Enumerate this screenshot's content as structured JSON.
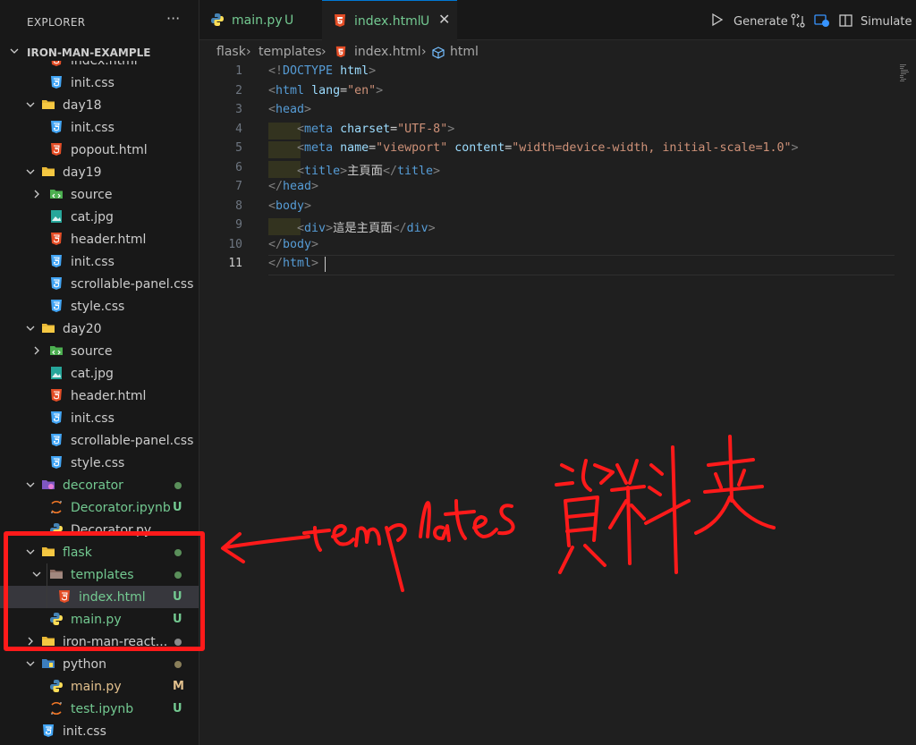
{
  "sidebar": {
    "title": "EXPLORER",
    "more_icon": "ellipsis-icon",
    "project": "IRON-MAN-EXAMPLE",
    "items": [
      {
        "label": "index.html",
        "type": "html",
        "depth": 2,
        "status": "",
        "partial": true
      },
      {
        "label": "init.css",
        "type": "css",
        "depth": 2,
        "status": ""
      },
      {
        "label": "day18",
        "type": "folder",
        "depth": 1,
        "expanded": true,
        "status": ""
      },
      {
        "label": "init.css",
        "type": "css",
        "depth": 2,
        "status": ""
      },
      {
        "label": "popout.html",
        "type": "html",
        "depth": 2,
        "status": ""
      },
      {
        "label": "day19",
        "type": "folder",
        "depth": 1,
        "expanded": true,
        "status": ""
      },
      {
        "label": "source",
        "type": "source-folder",
        "depth": 2,
        "expanded": false,
        "status": ""
      },
      {
        "label": "cat.jpg",
        "type": "image",
        "depth": 2,
        "status": ""
      },
      {
        "label": "header.html",
        "type": "html",
        "depth": 2,
        "status": ""
      },
      {
        "label": "init.css",
        "type": "css",
        "depth": 2,
        "status": ""
      },
      {
        "label": "scrollable-panel.css",
        "type": "css",
        "depth": 2,
        "status": ""
      },
      {
        "label": "style.css",
        "type": "css",
        "depth": 2,
        "status": ""
      },
      {
        "label": "day20",
        "type": "folder",
        "depth": 1,
        "expanded": true,
        "status": ""
      },
      {
        "label": "source",
        "type": "source-folder",
        "depth": 2,
        "expanded": false,
        "status": ""
      },
      {
        "label": "cat.jpg",
        "type": "image",
        "depth": 2,
        "status": ""
      },
      {
        "label": "header.html",
        "type": "html",
        "depth": 2,
        "status": ""
      },
      {
        "label": "init.css",
        "type": "css",
        "depth": 2,
        "status": ""
      },
      {
        "label": "scrollable-panel.css",
        "type": "css",
        "depth": 2,
        "status": ""
      },
      {
        "label": "style.css",
        "type": "css",
        "depth": 2,
        "status": ""
      },
      {
        "label": "decorator",
        "type": "decorator-folder",
        "depth": 1,
        "expanded": true,
        "status": "dot",
        "color": "#73c991"
      },
      {
        "label": "Decorator.ipynb",
        "type": "notebook",
        "depth": 2,
        "status": "U",
        "color": "#73c991"
      },
      {
        "label": "Decorator.py",
        "type": "python",
        "depth": 2,
        "status": "",
        "partial": true
      },
      {
        "label": "flask",
        "type": "folder",
        "depth": 1,
        "expanded": true,
        "status": "dot",
        "color": "#73c991"
      },
      {
        "label": "templates",
        "type": "template-folder",
        "depth": 2,
        "expanded": true,
        "status": "dot",
        "color": "#73c991"
      },
      {
        "label": "index.html",
        "type": "html",
        "depth": 3,
        "status": "U",
        "color": "#73c991",
        "selected": true
      },
      {
        "label": "main.py",
        "type": "python",
        "depth": 2,
        "status": "U",
        "color": "#73c991"
      },
      {
        "label": "iron-man-react...",
        "type": "folder",
        "depth": 1,
        "expanded": false,
        "status": "dot",
        "color": "#cccccc",
        "dotcolor": "#8a8a8a"
      },
      {
        "label": "python",
        "type": "python-folder",
        "depth": 1,
        "expanded": true,
        "status": "dot",
        "color": "#cccccc",
        "dotcolor": "#8a7f5a"
      },
      {
        "label": "main.py",
        "type": "python",
        "depth": 2,
        "status": "M",
        "color": "#e2c08d"
      },
      {
        "label": "test.ipynb",
        "type": "notebook",
        "depth": 2,
        "status": "U",
        "color": "#73c991"
      },
      {
        "label": "init.css",
        "type": "css",
        "depth": 1,
        "status": ""
      }
    ]
  },
  "tabs": [
    {
      "label": "main.py",
      "status": "U",
      "icon": "python-icon",
      "active": false
    },
    {
      "label": "index.html",
      "status": "U",
      "icon": "html5-icon",
      "active": true
    }
  ],
  "actions": {
    "generate_label": "Generate",
    "simulate_label": "Simulate"
  },
  "breadcrumb": {
    "items": [
      "flask",
      "templates",
      "index.html",
      "html"
    ]
  },
  "editor": {
    "line_numbers": [
      "1",
      "2",
      "3",
      "4",
      "5",
      "6",
      "7",
      "8",
      "9",
      "10",
      "11"
    ],
    "current_line": "11",
    "code": [
      [
        [
          "punc",
          "<!"
        ],
        [
          "tag",
          "DOCTYPE"
        ],
        [
          "text",
          " "
        ],
        [
          "attr",
          "html"
        ],
        [
          "punc",
          ">"
        ]
      ],
      [
        [
          "punc",
          "<"
        ],
        [
          "tag",
          "html"
        ],
        [
          "text",
          " "
        ],
        [
          "attr",
          "lang"
        ],
        [
          "text",
          "="
        ],
        [
          "str",
          "\"en\""
        ],
        [
          "punc",
          ">"
        ]
      ],
      [
        [
          "punc",
          "<"
        ],
        [
          "tag",
          "head"
        ],
        [
          "punc",
          ">"
        ]
      ],
      [
        [
          "ws",
          "    "
        ],
        [
          "punc",
          "<"
        ],
        [
          "tag",
          "meta"
        ],
        [
          "text",
          " "
        ],
        [
          "attr",
          "charset"
        ],
        [
          "text",
          "="
        ],
        [
          "str",
          "\"UTF-8\""
        ],
        [
          "punc",
          ">"
        ]
      ],
      [
        [
          "ws",
          "    "
        ],
        [
          "punc",
          "<"
        ],
        [
          "tag",
          "meta"
        ],
        [
          "text",
          " "
        ],
        [
          "attr",
          "name"
        ],
        [
          "text",
          "="
        ],
        [
          "str",
          "\"viewport\""
        ],
        [
          "text",
          " "
        ],
        [
          "attr",
          "content"
        ],
        [
          "text",
          "="
        ],
        [
          "str",
          "\"width=device-width, initial-scale=1.0\""
        ],
        [
          "punc",
          ">"
        ]
      ],
      [
        [
          "ws",
          "    "
        ],
        [
          "punc",
          "<"
        ],
        [
          "tag",
          "title"
        ],
        [
          "punc",
          ">"
        ],
        [
          "text",
          "主頁面"
        ],
        [
          "punc",
          "</"
        ],
        [
          "tag",
          "title"
        ],
        [
          "punc",
          ">"
        ]
      ],
      [
        [
          "punc",
          "</"
        ],
        [
          "tag",
          "head"
        ],
        [
          "punc",
          ">"
        ]
      ],
      [
        [
          "punc",
          "<"
        ],
        [
          "tag",
          "body"
        ],
        [
          "punc",
          ">"
        ]
      ],
      [
        [
          "ws",
          "    "
        ],
        [
          "punc",
          "<"
        ],
        [
          "tag",
          "div"
        ],
        [
          "punc",
          ">"
        ],
        [
          "text",
          "這是主頁面"
        ],
        [
          "punc",
          "</"
        ],
        [
          "tag",
          "div"
        ],
        [
          "punc",
          ">"
        ]
      ],
      [
        [
          "punc",
          "</"
        ],
        [
          "tag",
          "body"
        ],
        [
          "punc",
          ">"
        ]
      ],
      [
        [
          "punc",
          "</"
        ],
        [
          "tag",
          "html"
        ],
        [
          "punc",
          ">"
        ]
      ]
    ]
  },
  "annotation": {
    "text": "templates",
    "text_cjk": "資料夾",
    "color": "#ff1a1a"
  }
}
